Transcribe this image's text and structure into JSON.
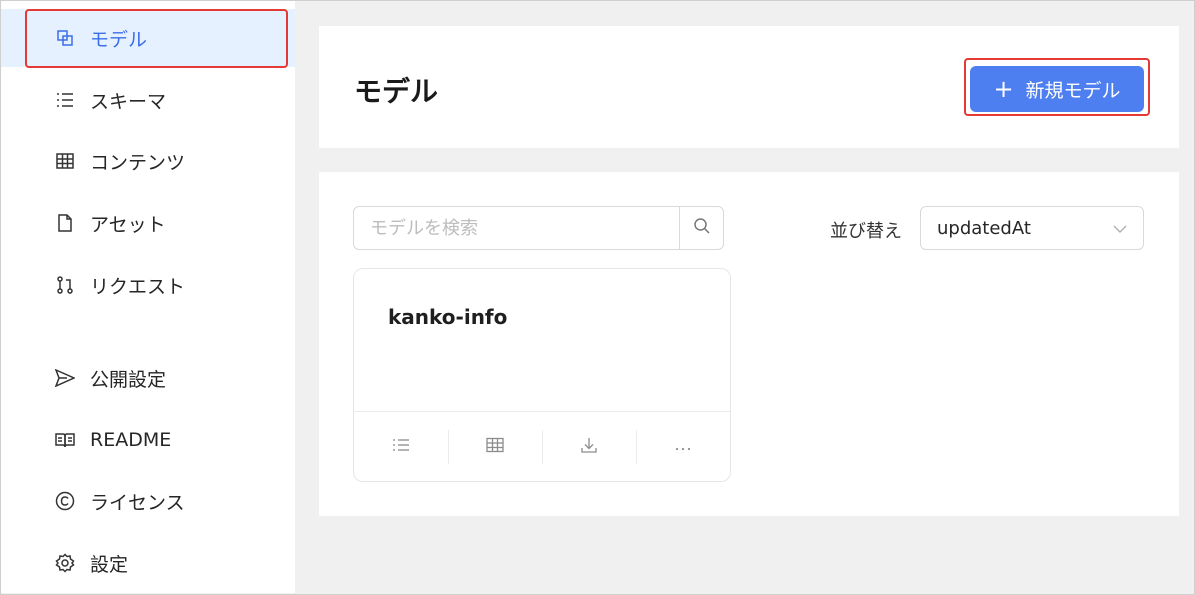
{
  "sidebar": {
    "items": [
      {
        "label": "モデル",
        "icon": "model-icon",
        "active": true
      },
      {
        "label": "スキーマ",
        "icon": "list-icon"
      },
      {
        "label": "コンテンツ",
        "icon": "table-icon"
      },
      {
        "label": "アセット",
        "icon": "file-icon"
      },
      {
        "label": "リクエスト",
        "icon": "pull-request-icon"
      },
      {
        "label": "公開設定",
        "icon": "send-icon"
      },
      {
        "label": "README",
        "icon": "book-icon"
      },
      {
        "label": "ライセンス",
        "icon": "copyright-icon"
      },
      {
        "label": "設定",
        "icon": "gear-icon"
      }
    ]
  },
  "header": {
    "title": "モデル",
    "new_button_label": "新規モデル"
  },
  "toolbar": {
    "search_placeholder": "モデルを検索",
    "sort_label": "並び替え",
    "sort_value": "updatedAt"
  },
  "models": [
    {
      "name": "kanko-info"
    }
  ],
  "colors": {
    "accent": "#4d7ff0",
    "active_bg": "#e6f1ff",
    "highlight": "#e53935"
  }
}
